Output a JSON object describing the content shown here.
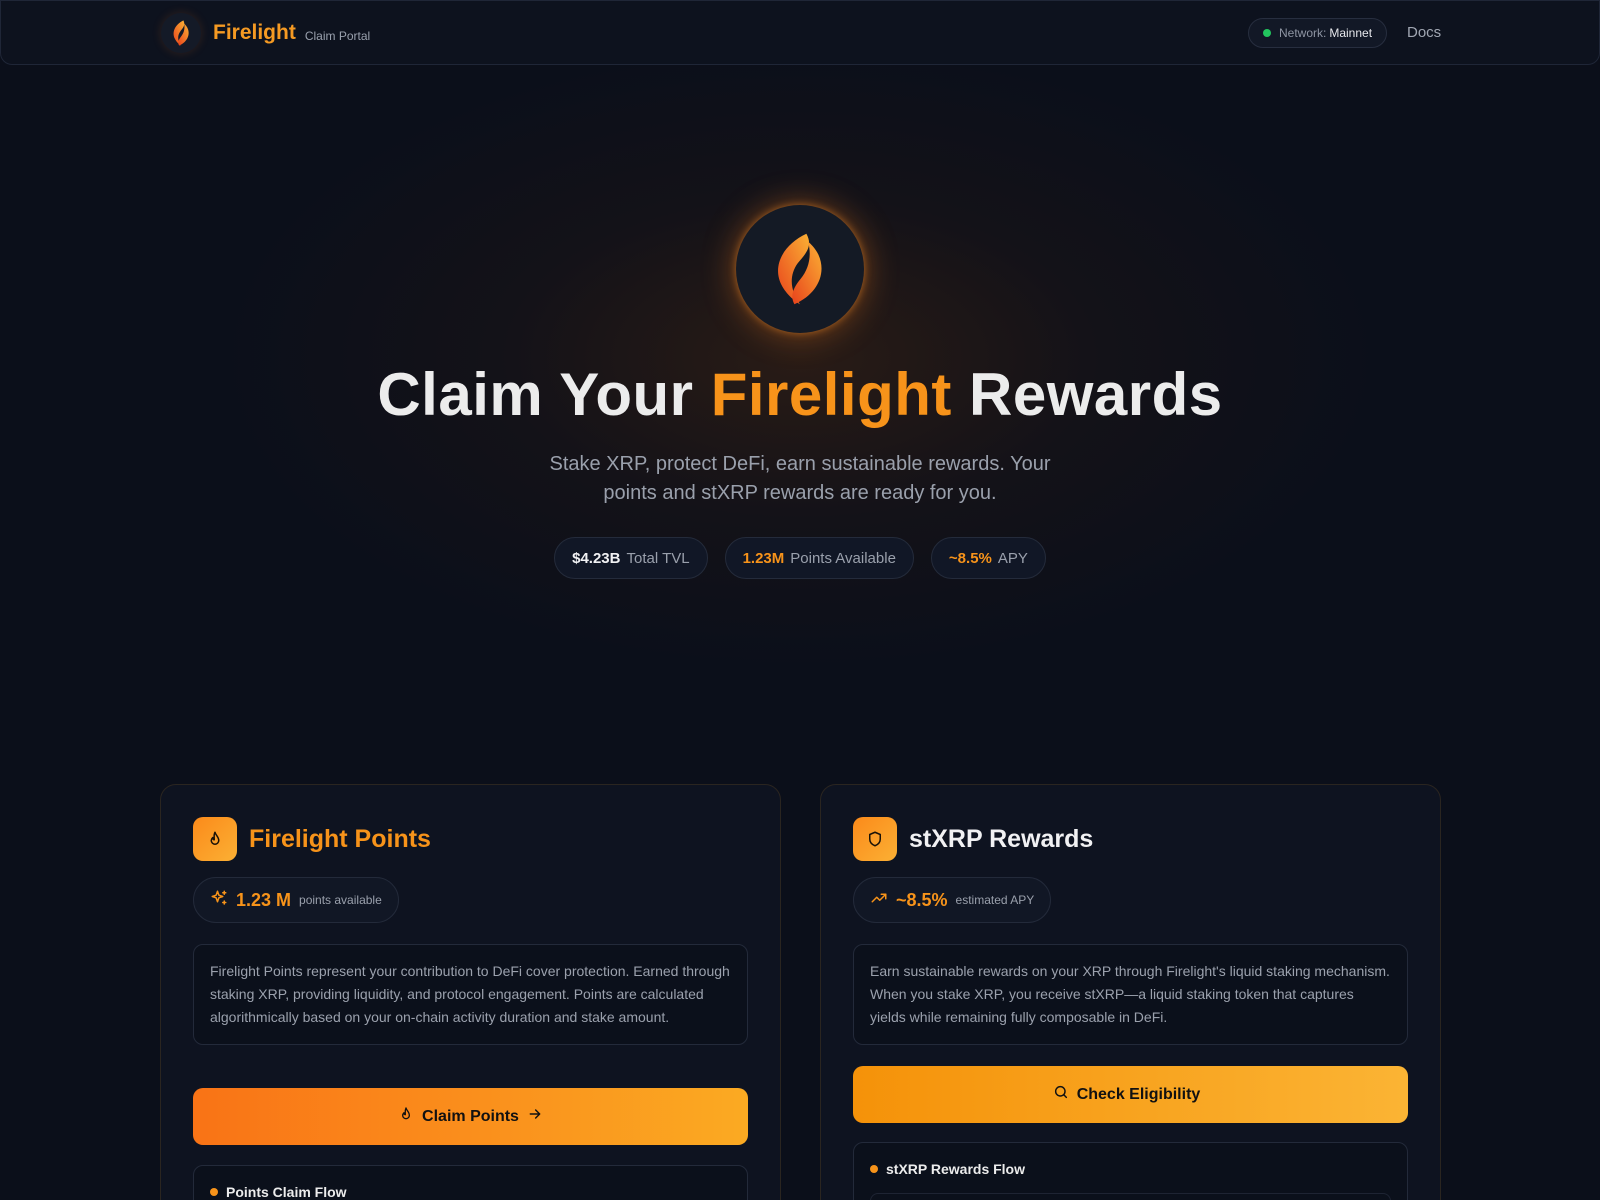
{
  "header": {
    "brand_name": "Firelight",
    "brand_sub": "Claim Portal",
    "network_label": "Network:",
    "network_value": "Mainnet",
    "network_status_color": "#22c55e",
    "docs_label": "Docs"
  },
  "hero": {
    "title_pre": "Claim Your ",
    "title_accent": "Firelight",
    "title_post": " Rewards",
    "subtitle": "Stake XRP, protect DeFi, earn sustainable rewards. Your points and stXRP rewards are ready for you.",
    "stats": [
      {
        "value": "$4.23B",
        "label": "Total TVL",
        "value_color": "#f1f1f3"
      },
      {
        "value": "1.23M",
        "label": "Points Available",
        "value_color": "#f7931a"
      },
      {
        "value": "~8.5%",
        "label": "APY",
        "value_color": "#f7931a"
      }
    ]
  },
  "cards": {
    "points": {
      "icon": "flame-icon",
      "title": "Firelight Points",
      "metric_icon": "sparkles-icon",
      "metric_value": "1.23 M",
      "metric_label": "points available",
      "description": "Firelight Points represent your contribution to DeFi cover protection. Earned through staking XRP, providing liquidity, and protocol engagement. Points are calculated algorithmically based on your on-chain activity duration and stake amount.",
      "cta_label": "Claim Points",
      "flow_title": "Points Claim Flow"
    },
    "rewards": {
      "icon": "shield-icon",
      "title": "stXRP Rewards",
      "metric_icon": "trending-up-icon",
      "metric_value": "~8.5%",
      "metric_label": "estimated APY",
      "description": "Earn sustainable rewards on your XRP through Firelight's liquid staking mechanism. When you stake XRP, you receive stXRP—a liquid staking token that captures yields while remaining fully composable in DeFi.",
      "cta_label": "Check Eligibility",
      "flow_title": "stXRP Rewards Flow"
    }
  },
  "colors": {
    "accent": "#f7931a",
    "background": "#0b0f1a",
    "card_background": "#0e1320"
  }
}
